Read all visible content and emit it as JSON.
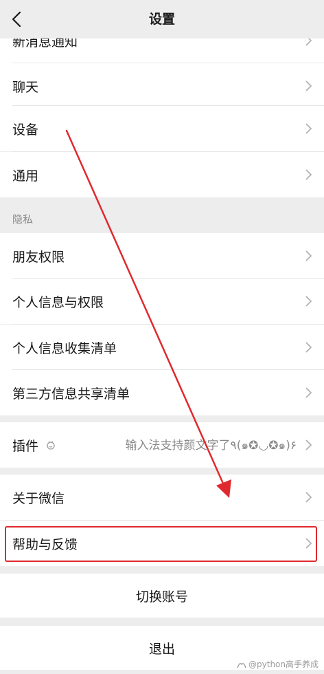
{
  "header": {
    "title": "设置"
  },
  "rows": {
    "new_message_notification": "新消息通知",
    "chat": "聊天",
    "devices": "设备",
    "general": "通用",
    "privacy_section": "隐私",
    "friend_permissions": "朋友权限",
    "personal_info_permissions": "个人信息与权限",
    "personal_info_collection": "个人信息收集清单",
    "third_party_sharing": "第三方信息共享清单",
    "plugins": "插件",
    "plugins_value": "输入法支持颜文字了٩(๑✪◡✪๑)۶",
    "about_wechat": "关于微信",
    "help_feedback": "帮助与反馈",
    "switch_account": "切换账号",
    "logout": "退出"
  },
  "watermark": "@python高手养成",
  "colors": {
    "annotation": "#e0292e",
    "background": "#ededed",
    "row": "#ffffff"
  }
}
